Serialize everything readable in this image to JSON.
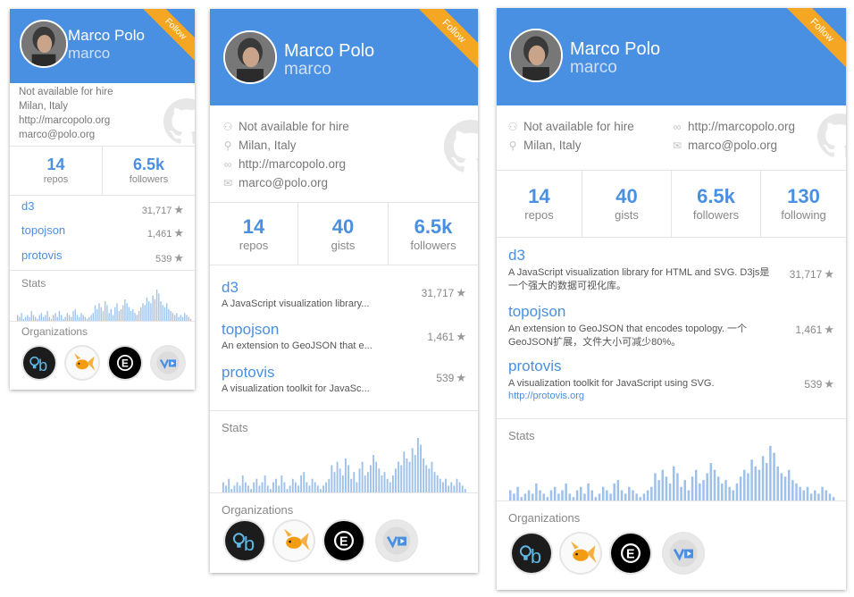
{
  "profile": {
    "name": "Marco Polo",
    "username": "marco",
    "follow_label": "Follow",
    "hire": "Not available for hire",
    "location": "Milan, Italy",
    "website": "http://marcopolo.org",
    "email": "marco@polo.org"
  },
  "stats": {
    "repos": {
      "value": "14",
      "label": "repos"
    },
    "gists": {
      "value": "40",
      "label": "gists"
    },
    "followers": {
      "value": "6.5k",
      "label": "followers"
    },
    "following": {
      "value": "130",
      "label": "following"
    }
  },
  "repos": [
    {
      "name": "d3",
      "stars": "31,717",
      "desc_short": "A JavaScript visualization library...",
      "desc_full": "A JavaScript visualization library for HTML and SVG. D3js是一个强大的数据可视化库。"
    },
    {
      "name": "topojson",
      "stars": "1,461",
      "desc_short": "An extension to GeoJSON that e...",
      "desc_full": "An extension to GeoJSON that encodes topology. 一个GeoJSON扩展，文件大小可减少80%。"
    },
    {
      "name": "protovis",
      "stars": "539",
      "desc_short": "A visualization toolkit for JavaSc...",
      "desc_full": "A visualization toolkit for JavaScript using SVG.",
      "link": "http://protovis.org"
    }
  ],
  "sections": {
    "stats_title": "Stats",
    "orgs_title": "Organizations"
  },
  "organizations": [
    {
      "name": "b",
      "icon": "bulb-b-logo-icon"
    },
    {
      "name": "goldfish",
      "icon": "goldfish-logo-icon"
    },
    {
      "name": "E",
      "icon": "e-logo-icon"
    },
    {
      "name": "vg",
      "icon": "vg-logo-icon"
    }
  ],
  "colors": {
    "header": "#4a90e2",
    "ribbon": "#f5a623",
    "link": "#4a90e2",
    "bars": "#9dc1ea"
  },
  "activity": [
    3,
    2,
    4,
    1,
    2,
    3,
    2,
    5,
    3,
    2,
    1,
    3,
    4,
    2,
    3,
    5,
    2,
    1,
    3,
    4,
    2,
    5,
    3,
    1,
    2,
    4,
    3,
    2,
    5,
    6,
    3,
    2,
    4,
    3,
    2,
    1,
    2,
    3,
    4,
    8,
    6,
    9,
    7,
    5,
    10,
    8,
    4,
    6,
    3,
    7,
    9,
    5,
    6,
    8,
    11,
    9,
    7,
    5,
    6,
    4,
    3,
    5,
    7,
    9,
    8,
    12,
    10,
    9,
    13,
    11,
    16,
    14,
    10,
    8,
    7,
    9,
    6,
    5,
    4,
    3,
    4,
    2,
    3,
    2,
    4,
    3,
    2,
    1
  ]
}
